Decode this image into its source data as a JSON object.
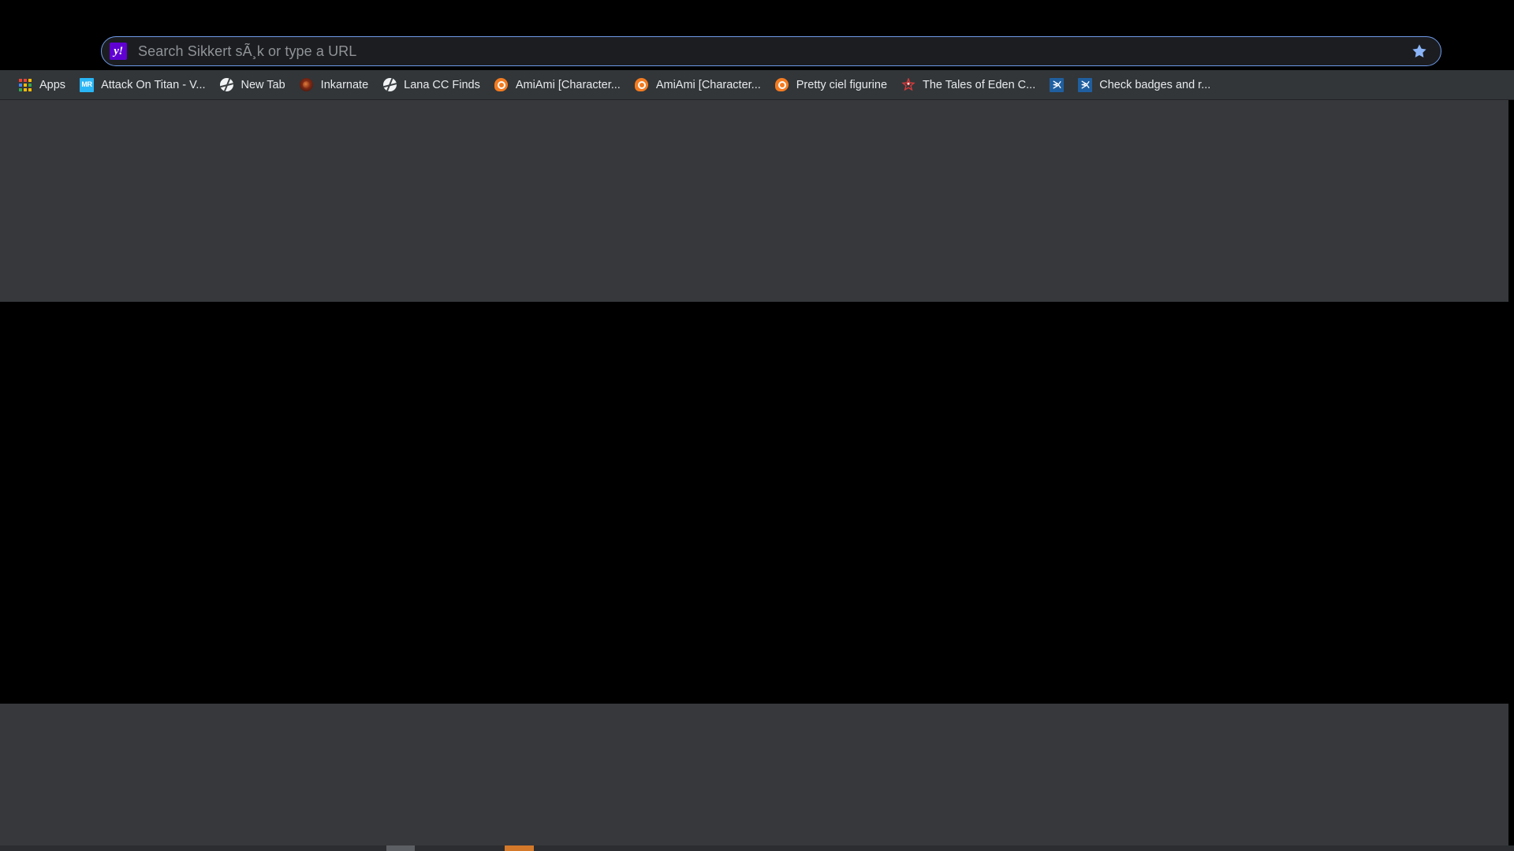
{
  "window": {
    "background": "#000000",
    "page_background": "#36383b",
    "page_band_color": "#000000"
  },
  "omnibox": {
    "name": "address-and-search-bar",
    "placeholder": "Search Sikkert sÃ¸k or type a URL",
    "value": "",
    "engine_icon": "yahoo-icon",
    "engine_glyph": "y!",
    "engine_color": "#6001d2",
    "border_color": "#6e9ae8",
    "bookmark_star_icon": "star-icon",
    "star_color": "#8ab4f8"
  },
  "bookmarks_bar": {
    "background": "#323639",
    "items": [
      {
        "label": "Apps",
        "icon": "apps-grid-icon",
        "has_label": true
      },
      {
        "label": "Attack On Titan - V...",
        "icon": "mr-icon",
        "has_label": true
      },
      {
        "label": "New Tab",
        "icon": "globe-icon",
        "has_label": true
      },
      {
        "label": "Inkarnate",
        "icon": "inkarnate-icon",
        "has_label": true
      },
      {
        "label": "Lana CC Finds",
        "icon": "globe-icon",
        "has_label": true
      },
      {
        "label": "AmiAmi [Character...",
        "icon": "amiami-icon",
        "has_label": true
      },
      {
        "label": "AmiAmi [Character...",
        "icon": "amiami-icon",
        "has_label": true
      },
      {
        "label": "Pretty ciel figurine",
        "icon": "amiami-icon",
        "has_label": true
      },
      {
        "label": "The Tales of Eden C...",
        "icon": "eden-star-icon",
        "has_label": true
      },
      {
        "label": "",
        "icon": "xsplit-icon",
        "has_label": false
      },
      {
        "label": "Check badges and r...",
        "icon": "xsplit-icon",
        "has_label": true
      }
    ],
    "apps_grid_colors": [
      "#ea4335",
      "#ea4335",
      "#fbbc04",
      "#4285f4",
      "#fbbc04",
      "#34a853",
      "#34a853",
      "#fbbc04",
      "#fbbc04"
    ]
  },
  "bottom_strip": {
    "name": "taskbar-progress-strip",
    "background": "#2b2d30",
    "segments": [
      {
        "name": "gray-segment",
        "color": "#5c5f63"
      },
      {
        "name": "orange-segment",
        "color": "#d4782a"
      }
    ]
  }
}
